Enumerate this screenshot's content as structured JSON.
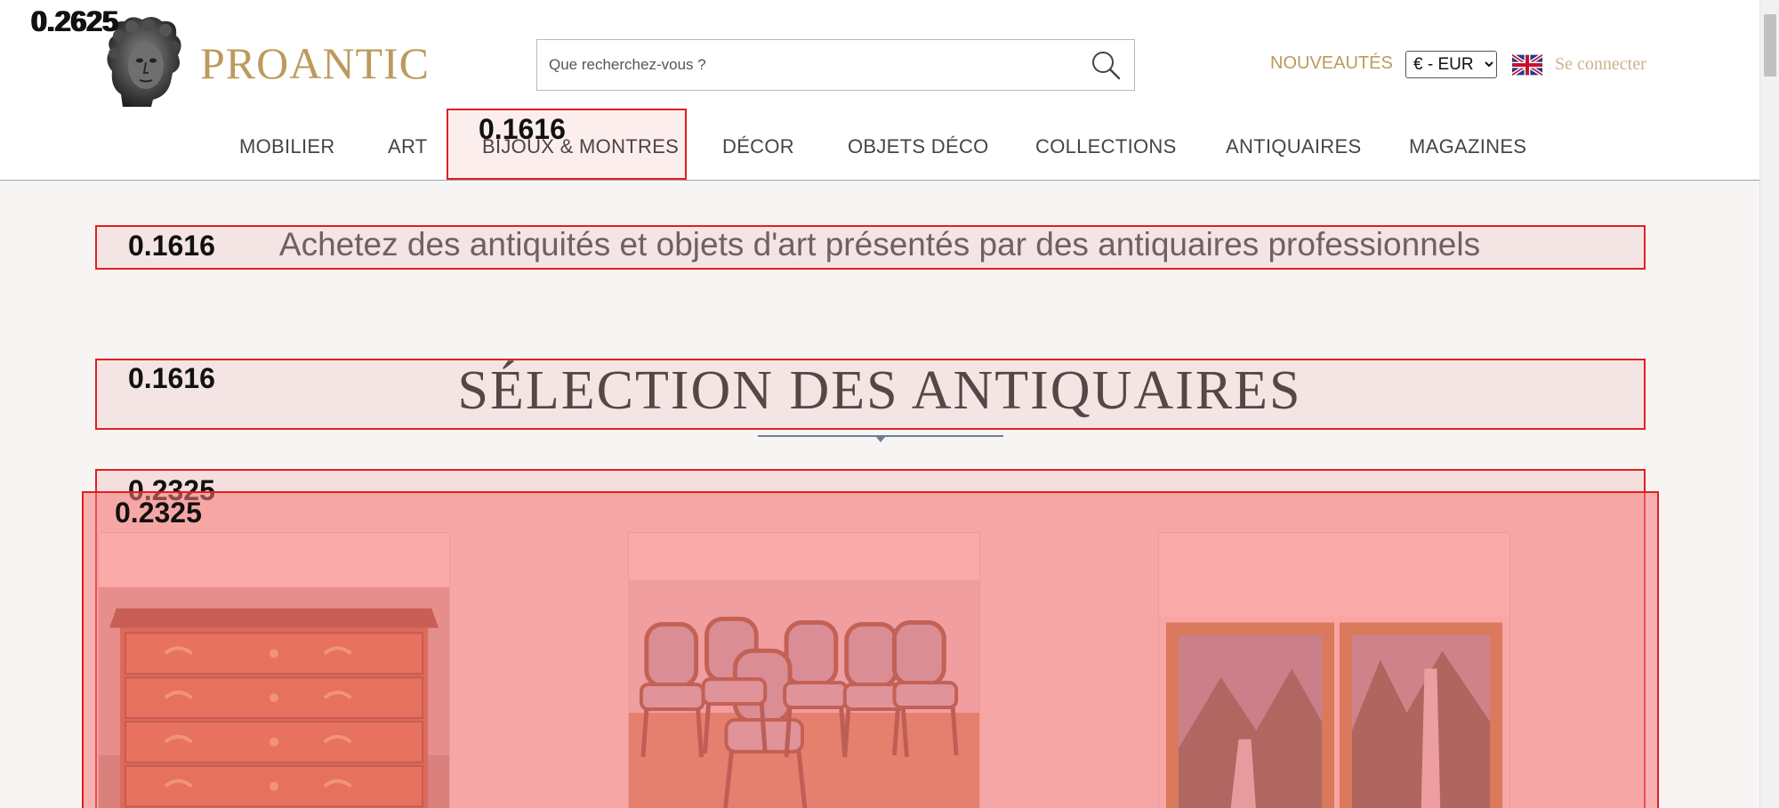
{
  "brand": {
    "name": "PROANTIC"
  },
  "search": {
    "placeholder": "Que recherchez-vous ?"
  },
  "header": {
    "nouveautes": "NOUVEAUTÉS",
    "currency": {
      "selected": "€ - EUR"
    },
    "login": "Se connecter"
  },
  "nav": {
    "items": [
      {
        "label": "MOBILIER"
      },
      {
        "label": "ART"
      },
      {
        "label": "BIJOUX & MONTRES"
      },
      {
        "label": "DÉCOR"
      },
      {
        "label": "OBJETS DÉCO"
      },
      {
        "label": "COLLECTIONS"
      },
      {
        "label": "ANTIQUAIRES"
      },
      {
        "label": "MAGAZINES"
      }
    ]
  },
  "main": {
    "tagline": "Achetez des antiquités et objets d'art présentés par des antiquaires professionnels",
    "section_title": "SÉLECTION DES ANTIQUAIRES",
    "products": [
      {
        "image": "antique-commode"
      },
      {
        "image": "set-of-chairs"
      },
      {
        "image": "pair-of-paintings"
      }
    ]
  },
  "overlays": {
    "top_left": [
      "0.2625",
      "0.2625"
    ],
    "nav_highlight": "0.1616",
    "tagline_box": "0.1616",
    "title_box": "0.1616",
    "products_box_a": "0.2325",
    "products_box_b": "0.2325"
  },
  "colors": {
    "brand_gold": "#bd9a5c",
    "overlay_red": "#e02020"
  }
}
